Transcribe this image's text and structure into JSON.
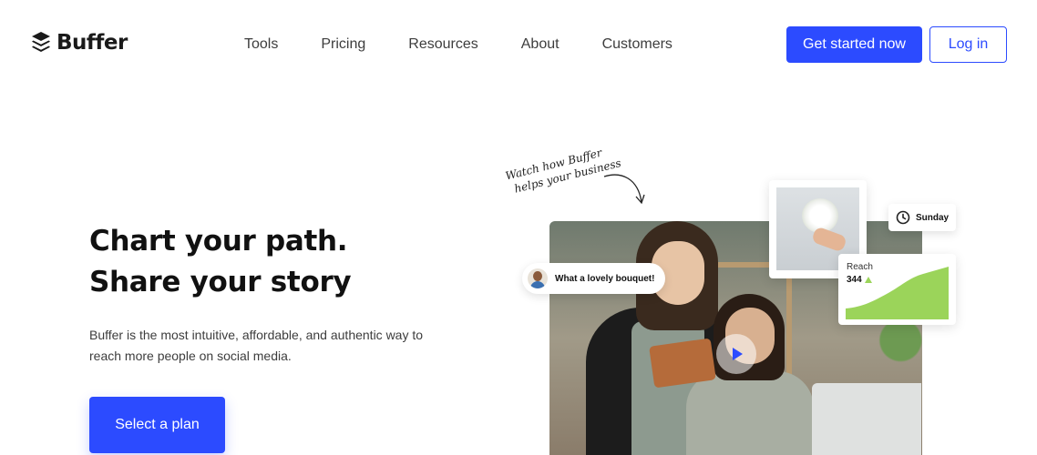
{
  "header": {
    "logo_text": "Buffer",
    "nav": [
      "Tools",
      "Pricing",
      "Resources",
      "About",
      "Customers"
    ],
    "cta_label": "Get started now",
    "login_label": "Log in"
  },
  "hero": {
    "title_line1": "Chart your path.",
    "title_line2": "Share your story",
    "description": "Buffer is the most intuitive, affordable, and authentic way to reach more people on social media.",
    "cta_label": "Select a plan"
  },
  "visual": {
    "note_line1": "Watch how Buffer",
    "note_line2": "helps your business",
    "comment_text": "What a lovely bouquet!",
    "schedule_day": "Sunday",
    "reach_label": "Reach",
    "reach_value": "344",
    "play_icon": "play-icon",
    "clock_icon": "clock-icon"
  },
  "colors": {
    "brand_blue": "#2c4bff",
    "reach_green": "#9bd45a"
  }
}
